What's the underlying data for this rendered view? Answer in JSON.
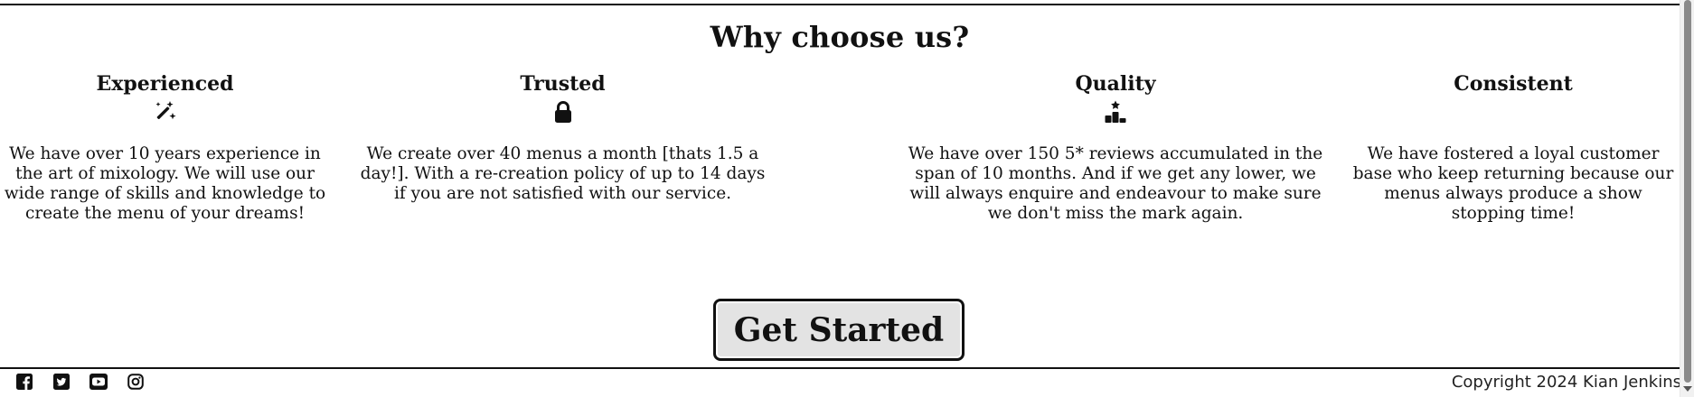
{
  "section": {
    "title": "Why choose us?"
  },
  "features": [
    {
      "title": "Experienced",
      "icon": "magic-wand-sparkles-icon",
      "text": "We have over 10 years experience in the art of mixology. We will use our wide range of skills and knowledge to create the menu of your dreams!"
    },
    {
      "title": "Trusted",
      "icon": "lock-icon",
      "text": "We create over 40 menus a month [thats 1.5 a day!]. With a re-creation policy of up to 14 days if you are not satisfied with our service."
    },
    {
      "title": "Quality",
      "icon": "ranking-star-icon",
      "text": "We have over 150 5* reviews accumulated in the span of 10 months. And if we get any lower, we will always enquire and endeavour to make sure we don't miss the mark again."
    },
    {
      "title": "Consistent",
      "text": "We have fostered a loyal customer base who keep returning because our menus always produce a show stopping time!"
    }
  ],
  "cta": {
    "label": "Get Started"
  },
  "footer": {
    "socials": [
      "facebook-icon",
      "twitter-icon",
      "youtube-icon",
      "instagram-icon"
    ],
    "copyright": "Copyright 2024 Kian Jenkins"
  },
  "colors": {
    "text": "#111111",
    "button_bg": "#e3e3e3",
    "background": "#ffffff"
  }
}
